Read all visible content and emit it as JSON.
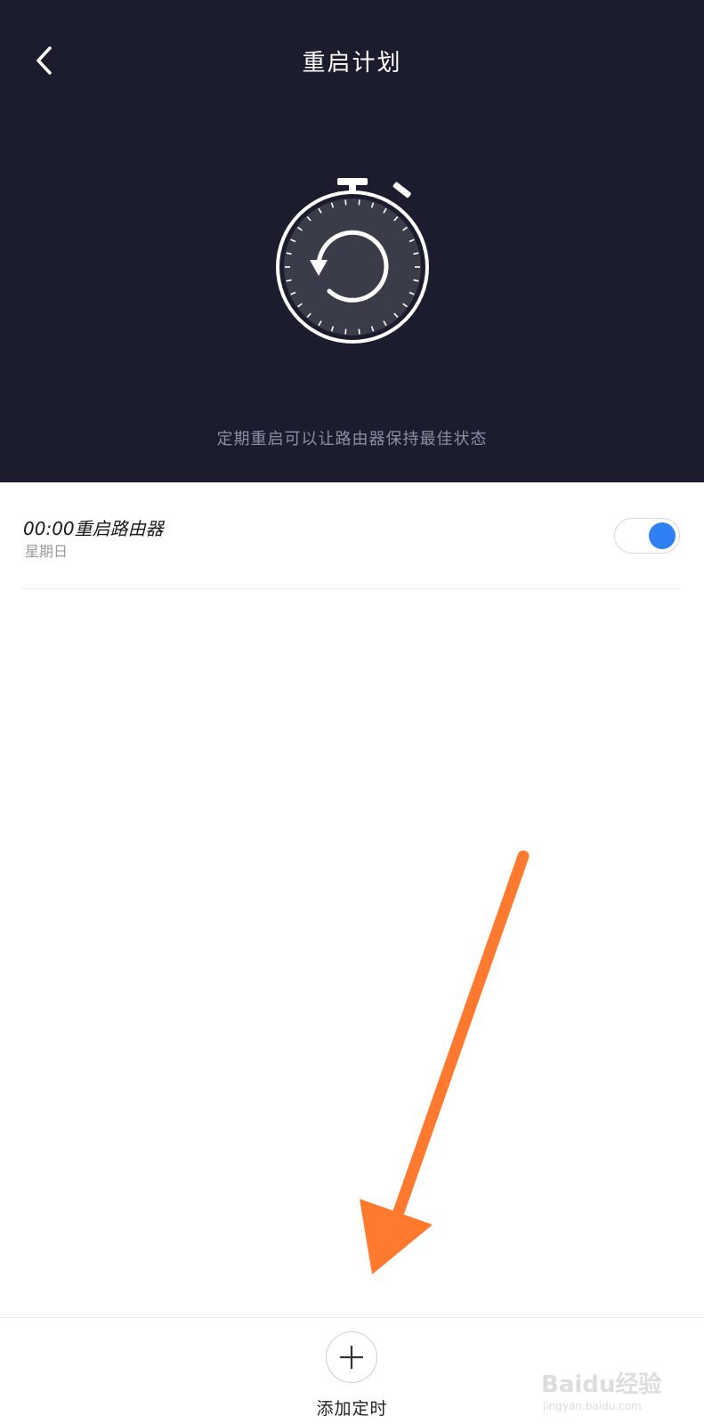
{
  "header": {
    "title": "重启计划",
    "subtitle": "定期重启可以让路由器保持最佳状态",
    "background_color": "#1b1d2e",
    "timer_icon": "stopwatch-restart-icon"
  },
  "schedule": {
    "items": [
      {
        "title": "00:00重启路由器",
        "days": "星期日",
        "enabled": true
      }
    ],
    "toggle_color": "#2f80f5"
  },
  "footer": {
    "add_label": "添加定时",
    "add_icon": "plus-icon"
  },
  "overlay": {
    "arrow_color": "#ff7a2e",
    "watermark_text": "Baidu经验",
    "watermark_sub": "jingyan.baidu.com"
  }
}
